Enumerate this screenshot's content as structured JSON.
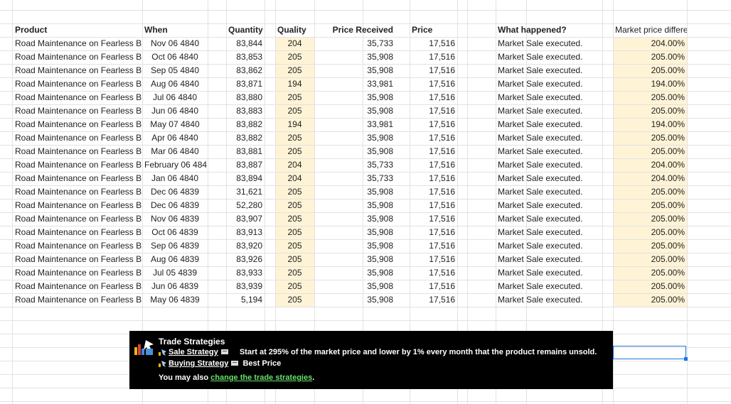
{
  "headers": {
    "product": "Product",
    "when": "When",
    "quantity": "Quantity",
    "quality": "Quality",
    "price_received": "Price Received",
    "price": "Price",
    "what_happened": "What happened?",
    "market_price_difference": "Market price difference"
  },
  "rows": [
    {
      "product": "Road Maintenance on Fearless B",
      "when": "Nov 06 4840",
      "quantity": "83,844",
      "quality": "204",
      "price_received": "35,733",
      "price": "17,516",
      "what": "Market Sale executed.",
      "mpd": "204.00%"
    },
    {
      "product": "Road Maintenance on Fearless B",
      "when": "Oct 06 4840",
      "quantity": "83,853",
      "quality": "205",
      "price_received": "35,908",
      "price": "17,516",
      "what": "Market Sale executed.",
      "mpd": "205.00%"
    },
    {
      "product": "Road Maintenance on Fearless B",
      "when": "Sep 05 4840",
      "quantity": "83,862",
      "quality": "205",
      "price_received": "35,908",
      "price": "17,516",
      "what": "Market Sale executed.",
      "mpd": "205.00%"
    },
    {
      "product": "Road Maintenance on Fearless B",
      "when": "Aug 06 4840",
      "quantity": "83,871",
      "quality": "194",
      "price_received": "33,981",
      "price": "17,516",
      "what": "Market Sale executed.",
      "mpd": "194.00%"
    },
    {
      "product": "Road Maintenance on Fearless B",
      "when": "Jul 06 4840",
      "quantity": "83,880",
      "quality": "205",
      "price_received": "35,908",
      "price": "17,516",
      "what": "Market Sale executed.",
      "mpd": "205.00%"
    },
    {
      "product": "Road Maintenance on Fearless B",
      "when": "Jun 06 4840",
      "quantity": "83,883",
      "quality": "205",
      "price_received": "35,908",
      "price": "17,516",
      "what": "Market Sale executed.",
      "mpd": "205.00%"
    },
    {
      "product": "Road Maintenance on Fearless B",
      "when": "May 07 4840",
      "quantity": "83,882",
      "quality": "194",
      "price_received": "33,981",
      "price": "17,516",
      "what": "Market Sale executed.",
      "mpd": "194.00%"
    },
    {
      "product": "Road Maintenance on Fearless B",
      "when": "Apr 06 4840",
      "quantity": "83,882",
      "quality": "205",
      "price_received": "35,908",
      "price": "17,516",
      "what": "Market Sale executed.",
      "mpd": "205.00%"
    },
    {
      "product": "Road Maintenance on Fearless B",
      "when": "Mar 06 4840",
      "quantity": "83,881",
      "quality": "205",
      "price_received": "35,908",
      "price": "17,516",
      "what": "Market Sale executed.",
      "mpd": "205.00%"
    },
    {
      "product": "Road Maintenance on Fearless B",
      "when": "February 06 484",
      "quantity": "83,887",
      "quality": "204",
      "price_received": "35,733",
      "price": "17,516",
      "what": "Market Sale executed.",
      "mpd": "204.00%",
      "when_left": true
    },
    {
      "product": "Road Maintenance on Fearless B",
      "when": "Jan 06 4840",
      "quantity": "83,894",
      "quality": "204",
      "price_received": "35,733",
      "price": "17,516",
      "what": "Market Sale executed.",
      "mpd": "204.00%"
    },
    {
      "product": "Road Maintenance on Fearless B",
      "when": "Dec 06 4839",
      "quantity": "31,621",
      "quality": "205",
      "price_received": "35,908",
      "price": "17,516",
      "what": "Market Sale executed.",
      "mpd": "205.00%"
    },
    {
      "product": "Road Maintenance on Fearless B",
      "when": "Dec 06 4839",
      "quantity": "52,280",
      "quality": "205",
      "price_received": "35,908",
      "price": "17,516",
      "what": "Market Sale executed.",
      "mpd": "205.00%"
    },
    {
      "product": "Road Maintenance on Fearless B",
      "when": "Nov 06 4839",
      "quantity": "83,907",
      "quality": "205",
      "price_received": "35,908",
      "price": "17,516",
      "what": "Market Sale executed.",
      "mpd": "205.00%"
    },
    {
      "product": "Road Maintenance on Fearless B",
      "when": "Oct 06 4839",
      "quantity": "83,913",
      "quality": "205",
      "price_received": "35,908",
      "price": "17,516",
      "what": "Market Sale executed.",
      "mpd": "205.00%"
    },
    {
      "product": "Road Maintenance on Fearless B",
      "when": "Sep 06 4839",
      "quantity": "83,920",
      "quality": "205",
      "price_received": "35,908",
      "price": "17,516",
      "what": "Market Sale executed.",
      "mpd": "205.00%"
    },
    {
      "product": "Road Maintenance on Fearless B",
      "when": "Aug 06 4839",
      "quantity": "83,926",
      "quality": "205",
      "price_received": "35,908",
      "price": "17,516",
      "what": "Market Sale executed.",
      "mpd": "205.00%"
    },
    {
      "product": "Road Maintenance on Fearless B",
      "when": "Jul 05 4839",
      "quantity": "83,933",
      "quality": "205",
      "price_received": "35,908",
      "price": "17,516",
      "what": "Market Sale executed.",
      "mpd": "205.00%"
    },
    {
      "product": "Road Maintenance on Fearless B",
      "when": "Jun 06 4839",
      "quantity": "83,939",
      "quality": "205",
      "price_received": "35,908",
      "price": "17,516",
      "what": "Market Sale executed.",
      "mpd": "205.00%"
    },
    {
      "product": "Road Maintenance on Fearless B",
      "when": "May 06 4839",
      "quantity": "5,194",
      "quality": "205",
      "price_received": "35,908",
      "price": "17,516",
      "what": "Market Sale executed.",
      "mpd": "205.00%"
    }
  ],
  "banner": {
    "title": "Trade Strategies",
    "sale_strategy_label": "Sale Strategy",
    "sale_strategy_desc": "Start at 295% of the market price and lower by 1% every month that the product remains unsold.",
    "buying_strategy_label": "Buying Strategy",
    "buying_strategy_desc": "Best Price",
    "footer_prefix": "You may also ",
    "footer_link": "change the trade strategies",
    "footer_suffix": "."
  },
  "colors": {
    "highlight": "#fff3d6",
    "banner_bg": "#000000",
    "link_green": "#66e06a",
    "selection": "#1a73e8"
  }
}
